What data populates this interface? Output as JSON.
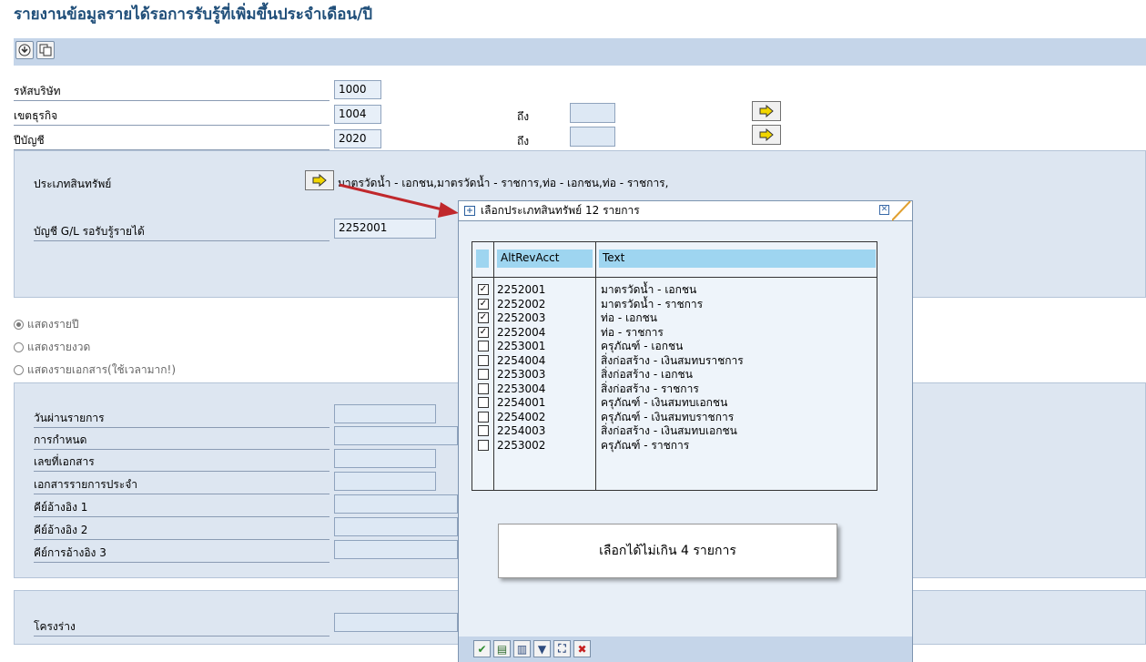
{
  "title": "รายงานข้อมูลรายได้รอการรับรู้ที่เพิ่มขึ้นประจำเดือน/ปี",
  "toolbar": {
    "icons": [
      "execute-icon",
      "copy-icon"
    ]
  },
  "header_fields": {
    "company_code": {
      "label": "รหัสบริษัท",
      "value": "1000"
    },
    "business_area": {
      "label": "เขตธุรกิจ",
      "value": "1004",
      "to_label": "ถึง"
    },
    "fiscal_year": {
      "label": "ปีบัญชี",
      "value": "2020",
      "to_label": "ถึง"
    }
  },
  "asset_panel": {
    "asset_type_label": "ประเภทสินทรัพย์",
    "asset_type_value": "มาตรวัดน้ำ - เอกชน,มาตรวัดน้ำ - ราชการ,ท่อ - เอกชน,ท่อ - ราชการ,",
    "gl_label": "บัญชี G/L รอรับรู้รายได้",
    "gl_value": "2252001"
  },
  "radios": [
    "แสดงรายปี",
    "แสดงรายงวด",
    "แสดงรายเอกสาร(ใช้เวลามาก!)"
  ],
  "doc_panel": {
    "fields": [
      "วันผ่านรายการ",
      "การกำหนด",
      "เลขที่เอกสาร",
      "เอกสารรายการประจำ",
      "คีย์อ้างอิง 1",
      "คีย์อ้างอิง 2",
      "คีย์การอ้างอิง 3"
    ]
  },
  "layout_panel": {
    "label": "โครงร่าง"
  },
  "popup": {
    "title": "เลือกประเภทสินทรัพย์ 12 รายการ",
    "col_account": "AltRevAcct",
    "col_text": "Text",
    "rows": [
      {
        "account": "2252001",
        "text": "มาตรวัดน้ำ - เอกชน",
        "checked": true
      },
      {
        "account": "2252002",
        "text": "มาตรวัดน้ำ - ราชการ",
        "checked": true
      },
      {
        "account": "2252003",
        "text": "ท่อ - เอกชน",
        "checked": true
      },
      {
        "account": "2252004",
        "text": "ท่อ - ราชการ",
        "checked": true
      },
      {
        "account": "2253001",
        "text": "ครุภัณฑ์ - เอกชน",
        "checked": false
      },
      {
        "account": "2254004",
        "text": "สิ่งก่อสร้าง - เงินสมทบราชการ",
        "checked": false
      },
      {
        "account": "2253003",
        "text": "สิ่งก่อสร้าง - เอกชน",
        "checked": false
      },
      {
        "account": "2253004",
        "text": "สิ่งก่อสร้าง - ราชการ",
        "checked": false
      },
      {
        "account": "2254001",
        "text": "ครุภัณฑ์ - เงินสมทบเอกชน",
        "checked": false
      },
      {
        "account": "2254002",
        "text": "ครุภัณฑ์ - เงินสมทบราชการ",
        "checked": false
      },
      {
        "account": "2254003",
        "text": "สิ่งก่อสร้าง - เงินสมทบเอกชน",
        "checked": false
      },
      {
        "account": "2253002",
        "text": "ครุภัณฑ์ - ราชการ",
        "checked": false
      }
    ],
    "tooltip": "เลือกได้ไม่เกิน 4 รายการ",
    "check_mark": "✓",
    "footer_buttons": [
      {
        "name": "confirm-icon",
        "glyph": "✔",
        "color": "#2e8b2e"
      },
      {
        "name": "select-all-icon",
        "glyph": "▤",
        "color": "#2e6b2e"
      },
      {
        "name": "deselect-all-icon",
        "glyph": "▥",
        "color": "#2e4b7e"
      },
      {
        "name": "filter-icon",
        "glyph": "▼",
        "color": "#2e4b7e"
      },
      {
        "name": "find-icon",
        "glyph": "⛶",
        "color": "#2e4b7e"
      },
      {
        "name": "cancel-icon",
        "glyph": "✖",
        "color": "#c62020"
      }
    ]
  },
  "colors": {
    "title": "#1f4e79",
    "toolbar": "#c5d5e9",
    "panel": "#dde6f1",
    "header_cell": "#9ed5f0",
    "arrow": "#c0282c"
  }
}
